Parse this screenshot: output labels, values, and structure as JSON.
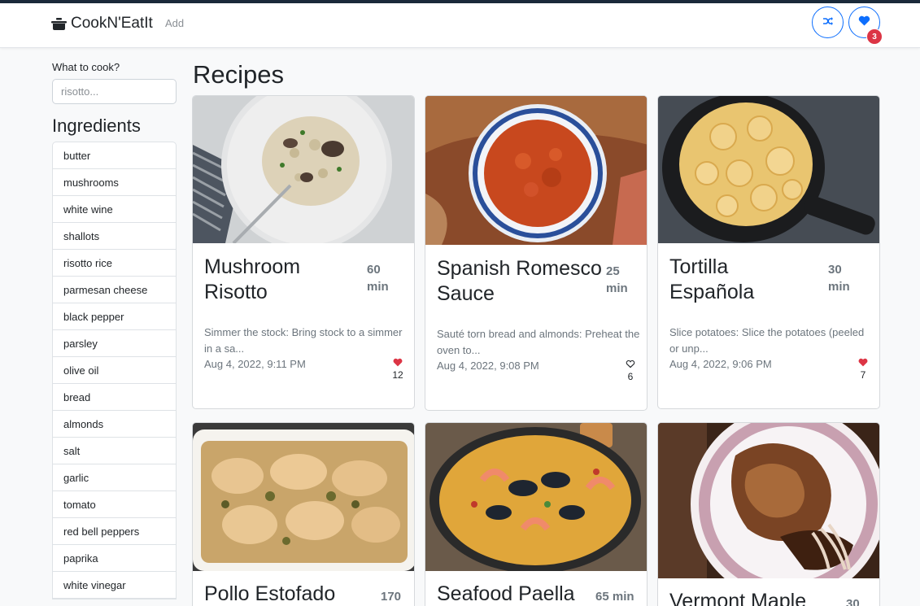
{
  "app": {
    "brand": "CookN'EatIt",
    "nav_add": "Add",
    "favorites_count": "3"
  },
  "sidebar": {
    "search_label": "What to cook?",
    "search_placeholder": "risotto...",
    "search_value": "",
    "ingredients_heading": "Ingredients",
    "ingredients": [
      "butter",
      "mushrooms",
      "white wine",
      "shallots",
      "risotto rice",
      "parmesan cheese",
      "black pepper",
      "parsley",
      "olive oil",
      "bread",
      "almonds",
      "salt",
      "garlic",
      "tomato",
      "red bell peppers",
      "paprika",
      "white vinegar"
    ]
  },
  "main": {
    "title": "Recipes",
    "recipes": [
      {
        "title_line1": "Mushroom",
        "title_line2": "Risotto",
        "time_value": "60",
        "time_unit": "min",
        "description_line1": "Simmer the stock: Bring stock to a simmer",
        "description_line2": "in a sa...",
        "date": "Aug 4, 2022, 9:11 PM",
        "likes": "12",
        "favorited": true
      },
      {
        "title_line1": "Spanish Romesco",
        "title_line2": "Sauce",
        "time_value": "25",
        "time_unit": "min",
        "description_line1": "Sauté torn bread and almonds: Preheat the",
        "description_line2": "oven to...",
        "date": "Aug 4, 2022, 9:08 PM",
        "likes": "6",
        "favorited": false
      },
      {
        "title_line1": "Tortilla",
        "title_line2": "Española",
        "time_value": "30",
        "time_unit": "min",
        "description_line1": "Slice potatoes: Slice the potatoes (peeled",
        "description_line2": "or unp...",
        "date": "Aug 4, 2022, 9:06 PM",
        "likes": "7",
        "favorited": true
      },
      {
        "title_line1": "Pollo Estofado",
        "title_line2": "",
        "time_value": "170",
        "time_unit": "",
        "description_line1": "",
        "description_line2": "",
        "date": "",
        "likes": "",
        "favorited": false
      },
      {
        "title_line1": "Seafood Paella",
        "title_line2": "",
        "time_value": "65 min",
        "time_unit": "",
        "description_line1": "",
        "description_line2": "",
        "date": "",
        "likes": "",
        "favorited": false
      },
      {
        "title_line1": "Vermont Maple",
        "title_line2": "",
        "time_value": "30",
        "time_unit": "",
        "description_line1": "",
        "description_line2": "",
        "date": "",
        "likes": "",
        "favorited": false
      }
    ]
  },
  "colors": {
    "accent": "#0d6efd",
    "badge": "#dc3545",
    "heart": "#dc3545",
    "muted_text": "#6c757d"
  },
  "icons": {
    "brand": "cooking-pot-icon",
    "shuffle": "shuffle-icon",
    "favorites": "heart-icon",
    "like_filled": "heart-filled-icon",
    "like_outline": "heart-outline-icon"
  }
}
